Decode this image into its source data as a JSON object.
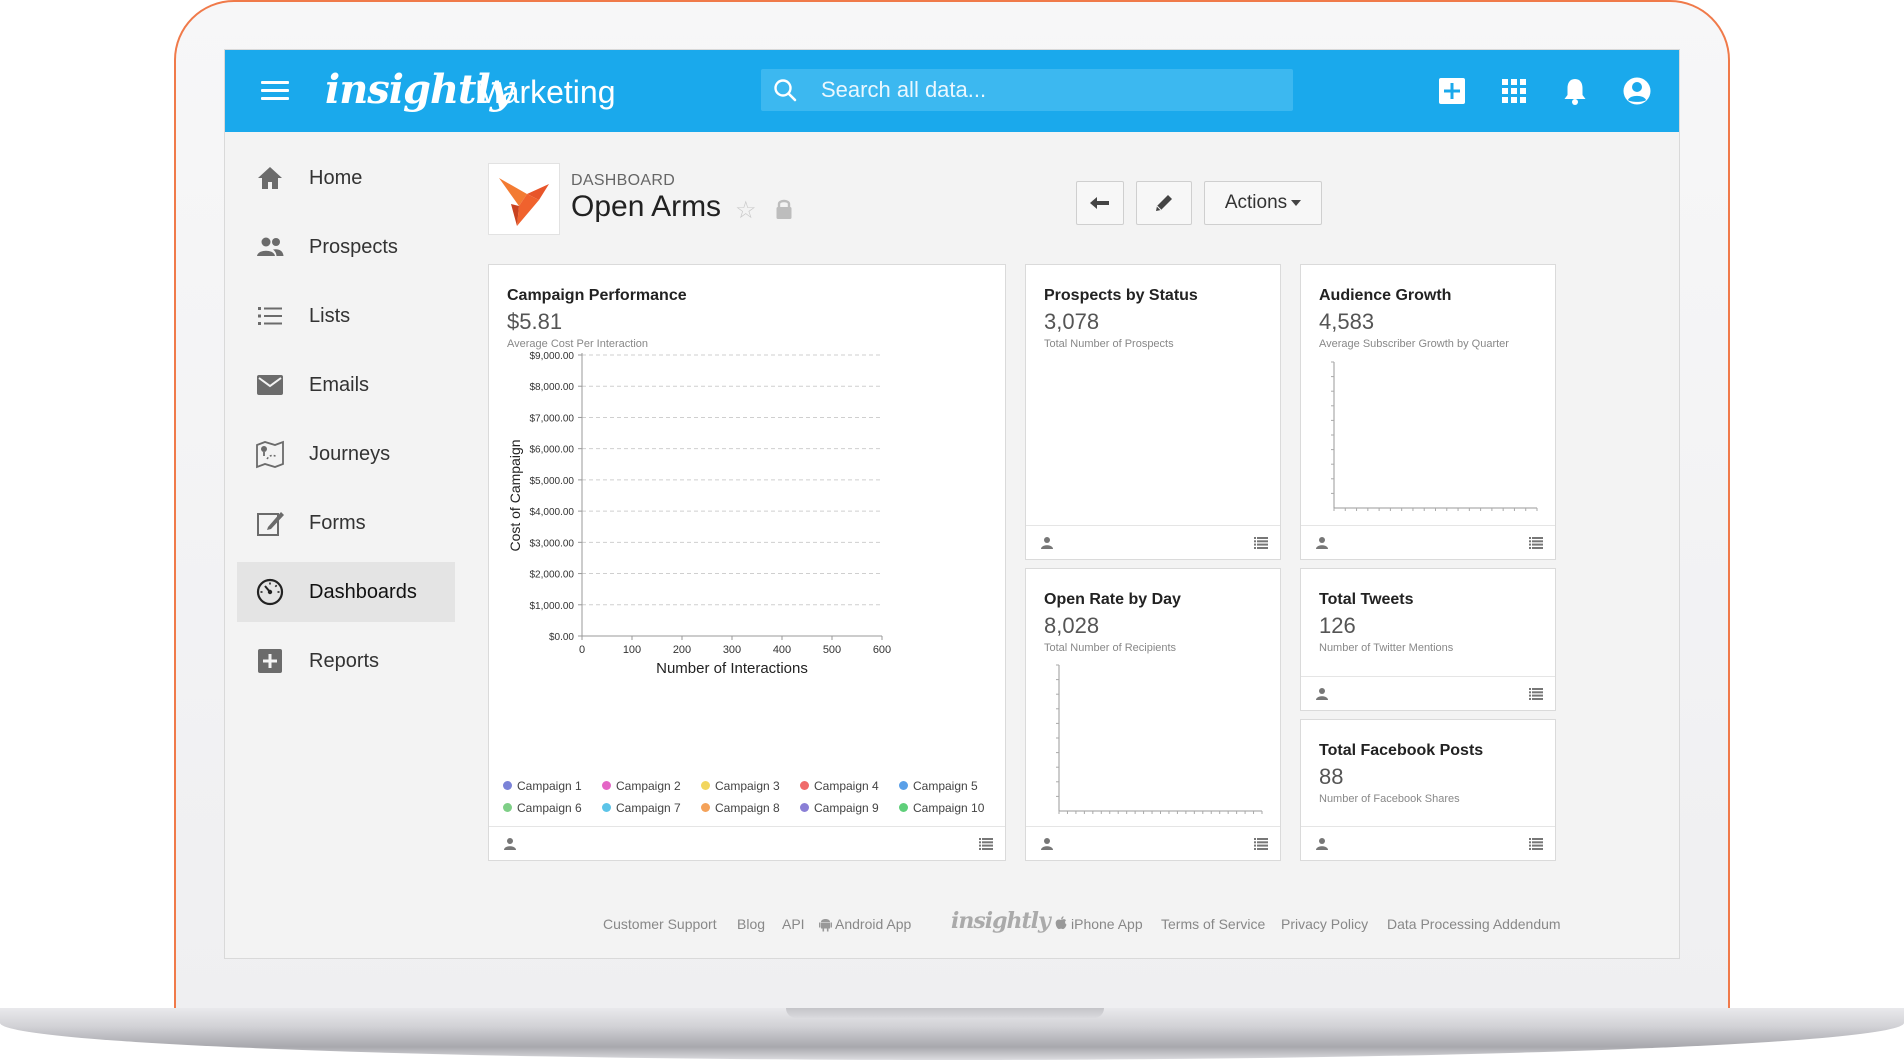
{
  "app": {
    "logo_text": "insightly",
    "module_name": "Marketing",
    "brand_color": "#1aa9ec"
  },
  "search": {
    "placeholder": "Search all data..."
  },
  "topbar_icons": [
    "add-icon",
    "apps-grid-icon",
    "bell-icon",
    "account-icon"
  ],
  "sidebar": {
    "items": [
      {
        "label": "Home",
        "icon": "home-icon"
      },
      {
        "label": "Prospects",
        "icon": "people-icon"
      },
      {
        "label": "Lists",
        "icon": "list-icon"
      },
      {
        "label": "Emails",
        "icon": "envelope-icon"
      },
      {
        "label": "Journeys",
        "icon": "map-icon"
      },
      {
        "label": "Forms",
        "icon": "edit-form-icon"
      },
      {
        "label": "Dashboards",
        "icon": "dashboard-gauge-icon",
        "active": true
      },
      {
        "label": "Reports",
        "icon": "report-icon"
      }
    ]
  },
  "header": {
    "kicker": "DASHBOARD",
    "title": "Open Arms",
    "actions_label": "Actions"
  },
  "cards": {
    "campaign": {
      "title": "Campaign Performance",
      "value": "$5.81",
      "subtitle": "Average Cost Per Interaction"
    },
    "prospects": {
      "title": "Prospects by Status",
      "value": "3,078",
      "subtitle": "Total Number of Prospects"
    },
    "audience": {
      "title": "Audience Growth",
      "value": "4,583",
      "subtitle": "Average Subscriber Growth by Quarter"
    },
    "open_rate": {
      "title": "Open Rate by Day",
      "value": "8,028",
      "subtitle": "Total Number of Recipients"
    },
    "tweets": {
      "title": "Total Tweets",
      "value": "126",
      "subtitle": "Number of Twitter Mentions"
    },
    "facebook": {
      "title": "Total Facebook Posts",
      "value": "88",
      "subtitle": "Number of Facebook Shares"
    }
  },
  "chart_data": {
    "type": "scatter",
    "title": "Campaign Performance",
    "xlabel": "Number of Interactions",
    "ylabel": "Cost of Campaign",
    "xlim": [
      0,
      600
    ],
    "ylim": [
      0,
      9000
    ],
    "x_ticks": [
      "0",
      "100",
      "200",
      "300",
      "400",
      "500",
      "600"
    ],
    "y_ticks": [
      "$0.00",
      "$1,000.00",
      "$2,000.00",
      "$3,000.00",
      "$4,000.00",
      "$5,000.00",
      "$6,000.00",
      "$7,000.00",
      "$8,000.00",
      "$9,000.00"
    ],
    "grid": true,
    "legend_position": "bottom",
    "series": [
      {
        "name": "Campaign 1",
        "color": "#7b83d8",
        "values": []
      },
      {
        "name": "Campaign 2",
        "color": "#e466c6",
        "values": []
      },
      {
        "name": "Campaign 3",
        "color": "#f2d65f",
        "values": []
      },
      {
        "name": "Campaign 4",
        "color": "#f06b6b",
        "values": []
      },
      {
        "name": "Campaign 5",
        "color": "#5aa0e8",
        "values": []
      },
      {
        "name": "Campaign 6",
        "color": "#7fcf87",
        "values": []
      },
      {
        "name": "Campaign 7",
        "color": "#5cc4e8",
        "values": []
      },
      {
        "name": "Campaign 8",
        "color": "#f4a25a",
        "values": []
      },
      {
        "name": "Campaign 9",
        "color": "#8a7fd6",
        "values": []
      },
      {
        "name": "Campaign 10",
        "color": "#5fcf7a",
        "values": []
      }
    ]
  },
  "footer": {
    "links": [
      "Customer Support",
      "Blog",
      "API",
      "Android App",
      "iPhone App",
      "Terms of Service",
      "Privacy Policy",
      "Data Processing Addendum"
    ],
    "logo_text": "insightly"
  }
}
